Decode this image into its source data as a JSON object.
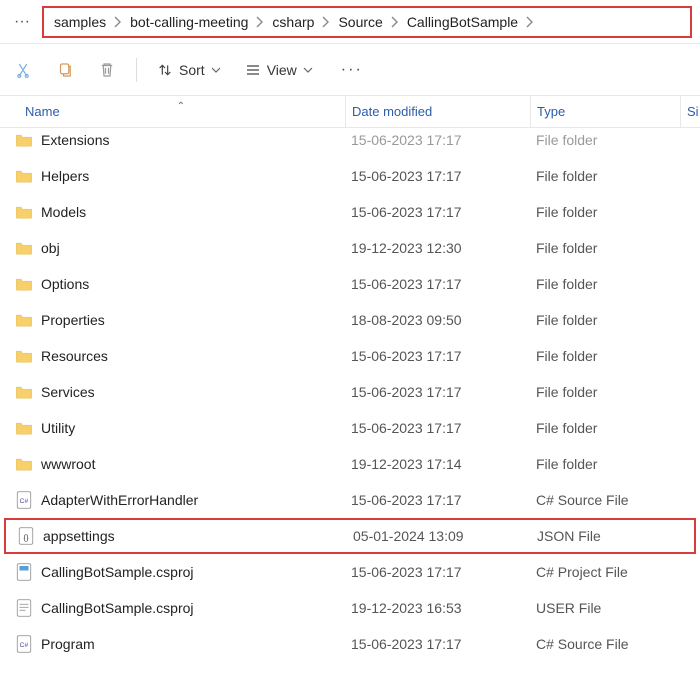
{
  "breadcrumb": {
    "items": [
      {
        "label": "samples"
      },
      {
        "label": "bot-calling-meeting"
      },
      {
        "label": "csharp"
      },
      {
        "label": "Source"
      },
      {
        "label": "CallingBotSample"
      }
    ]
  },
  "toolbar": {
    "sort_label": "Sort",
    "view_label": "View"
  },
  "columns": {
    "name": "Name",
    "date": "Date modified",
    "type": "Type",
    "size": "Si"
  },
  "files": [
    {
      "name": "Extensions",
      "date": "15-06-2023 17:17",
      "type": "File folder",
      "icon": "folder",
      "cutoff": true
    },
    {
      "name": "Helpers",
      "date": "15-06-2023 17:17",
      "type": "File folder",
      "icon": "folder"
    },
    {
      "name": "Models",
      "date": "15-06-2023 17:17",
      "type": "File folder",
      "icon": "folder"
    },
    {
      "name": "obj",
      "date": "19-12-2023 12:30",
      "type": "File folder",
      "icon": "folder"
    },
    {
      "name": "Options",
      "date": "15-06-2023 17:17",
      "type": "File folder",
      "icon": "folder"
    },
    {
      "name": "Properties",
      "date": "18-08-2023 09:50",
      "type": "File folder",
      "icon": "folder"
    },
    {
      "name": "Resources",
      "date": "15-06-2023 17:17",
      "type": "File folder",
      "icon": "folder"
    },
    {
      "name": "Services",
      "date": "15-06-2023 17:17",
      "type": "File folder",
      "icon": "folder"
    },
    {
      "name": "Utility",
      "date": "15-06-2023 17:17",
      "type": "File folder",
      "icon": "folder"
    },
    {
      "name": "wwwroot",
      "date": "19-12-2023 17:14",
      "type": "File folder",
      "icon": "folder"
    },
    {
      "name": "AdapterWithErrorHandler",
      "date": "15-06-2023 17:17",
      "type": "C# Source File",
      "icon": "cs"
    },
    {
      "name": "appsettings",
      "date": "05-01-2024 13:09",
      "type": "JSON File",
      "icon": "json",
      "highlight": true
    },
    {
      "name": "CallingBotSample.csproj",
      "date": "15-06-2023 17:17",
      "type": "C# Project File",
      "icon": "csproj"
    },
    {
      "name": "CallingBotSample.csproj",
      "date": "19-12-2023 16:53",
      "type": "USER File",
      "icon": "user"
    },
    {
      "name": "Program",
      "date": "15-06-2023 17:17",
      "type": "C# Source File",
      "icon": "cs"
    }
  ]
}
